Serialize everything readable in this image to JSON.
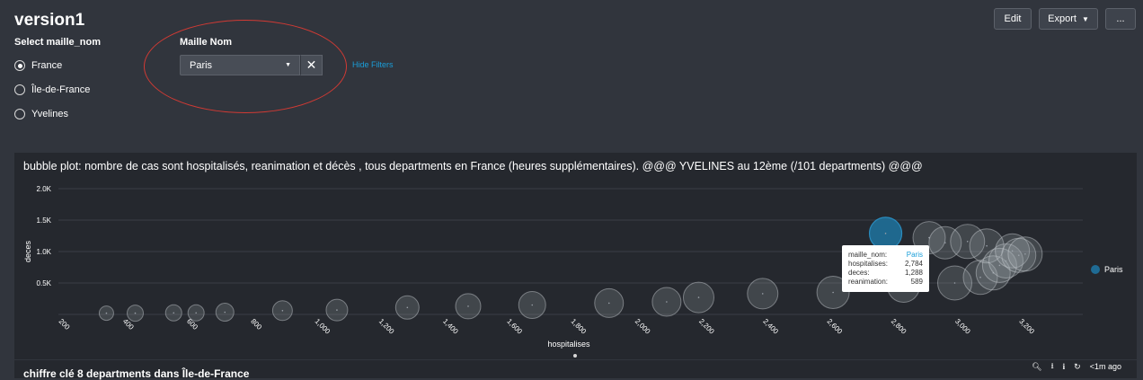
{
  "page": {
    "title": "version1",
    "buttons": {
      "edit": "Edit",
      "export": "Export",
      "more": "..."
    }
  },
  "filters": {
    "radio_label": "Select maille_nom",
    "radio_options": [
      "France",
      "Île-de-France",
      "Yvelines"
    ],
    "radio_selected": 0,
    "dropdown_label": "Maille Nom",
    "dropdown_value": "Paris",
    "hide_filters": "Hide Filters"
  },
  "panel": {
    "title": "bubble plot: nombre de cas sont hospitalisés, reanimation et décès , tous departments en France (heures supplémentaires). @@@ YVELINES au 12ème (/101 departments) @@@"
  },
  "panel2": {
    "title_partial": "chiffre clé 8 departments dans Île-de-France"
  },
  "chart_data": {
    "type": "scatter",
    "xlabel": "hospitalises",
    "ylabel": "deces",
    "xlim": [
      200,
      3400
    ],
    "ylim": [
      0,
      2000
    ],
    "x_ticks": [
      "200",
      "400",
      "600",
      "800",
      "1,000",
      "1,200",
      "1,400",
      "1,600",
      "1,800",
      "2,000",
      "2,200",
      "2,400",
      "2,600",
      "2,800",
      "3,000",
      "3,200"
    ],
    "y_ticks": [
      "0.5K",
      "1.0K",
      "1.5K",
      "2.0K"
    ],
    "legend": {
      "position": "right",
      "entries": [
        {
          "name": "Paris",
          "color": "#1f6b94"
        }
      ]
    },
    "points": [
      {
        "x": 350,
        "y": 20,
        "size": 8
      },
      {
        "x": 440,
        "y": 20,
        "size": 9
      },
      {
        "x": 560,
        "y": 25,
        "size": 9
      },
      {
        "x": 630,
        "y": 25,
        "size": 9
      },
      {
        "x": 720,
        "y": 35,
        "size": 10
      },
      {
        "x": 900,
        "y": 60,
        "size": 11
      },
      {
        "x": 1070,
        "y": 70,
        "size": 12
      },
      {
        "x": 1290,
        "y": 110,
        "size": 13
      },
      {
        "x": 1480,
        "y": 130,
        "size": 14
      },
      {
        "x": 1680,
        "y": 150,
        "size": 15
      },
      {
        "x": 1920,
        "y": 180,
        "size": 16
      },
      {
        "x": 2100,
        "y": 200,
        "size": 16
      },
      {
        "x": 2200,
        "y": 270,
        "size": 17
      },
      {
        "x": 2400,
        "y": 330,
        "size": 17
      },
      {
        "x": 2620,
        "y": 350,
        "size": 18
      },
      {
        "x": 2840,
        "y": 450,
        "size": 18
      },
      {
        "x": 2920,
        "y": 1220,
        "size": 18
      },
      {
        "x": 2970,
        "y": 1140,
        "size": 18
      },
      {
        "x": 3000,
        "y": 500,
        "size": 19
      },
      {
        "x": 3040,
        "y": 1160,
        "size": 19
      },
      {
        "x": 3080,
        "y": 590,
        "size": 19
      },
      {
        "x": 3100,
        "y": 1090,
        "size": 19
      },
      {
        "x": 3120,
        "y": 660,
        "size": 19
      },
      {
        "x": 3140,
        "y": 780,
        "size": 19
      },
      {
        "x": 3160,
        "y": 850,
        "size": 19
      },
      {
        "x": 3180,
        "y": 1010,
        "size": 19
      },
      {
        "x": 3200,
        "y": 940,
        "size": 19
      },
      {
        "x": 3220,
        "y": 960,
        "size": 19
      },
      {
        "x": 2784,
        "y": 1288,
        "size": 18,
        "highlight": true,
        "name": "Paris"
      }
    ],
    "tooltip": {
      "rows": [
        {
          "key": "maille_nom:",
          "value": "Paris"
        },
        {
          "key": "hospitalises:",
          "value": "2,784"
        },
        {
          "key": "deces:",
          "value": "1,288"
        },
        {
          "key": "reanimation:",
          "value": "589"
        }
      ]
    },
    "colors": {
      "bubble_fill": "#aab0b8",
      "highlight": "#1f6b94",
      "link": "#1a9ed9"
    }
  },
  "toolbar": {
    "search": "search-icon",
    "download": "download-icon",
    "info": "info-icon",
    "refresh": "refresh-icon",
    "updated": "<1m ago"
  }
}
